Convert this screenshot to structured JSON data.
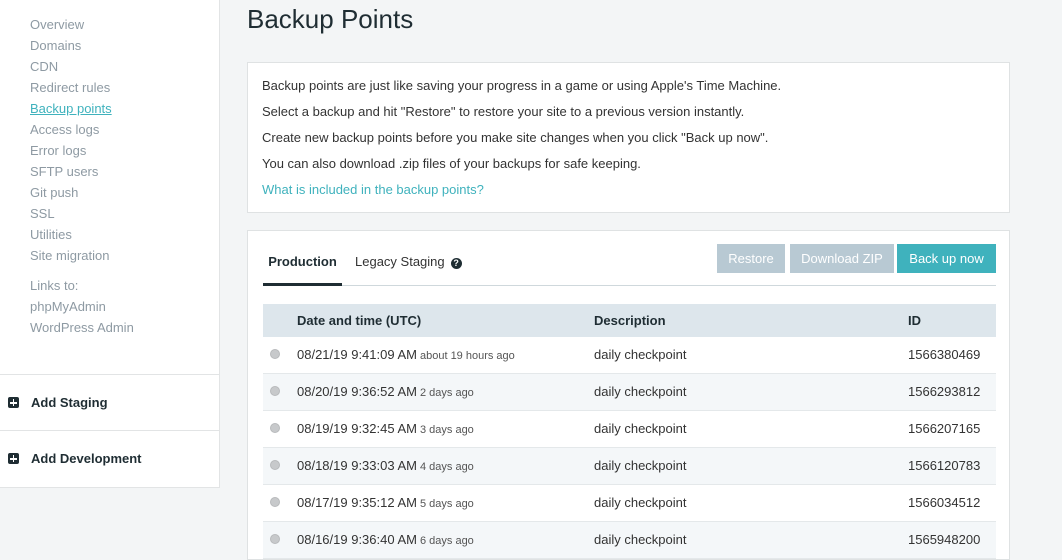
{
  "sidebar": {
    "nav": [
      {
        "label": "Overview",
        "active": false
      },
      {
        "label": "Domains",
        "active": false
      },
      {
        "label": "CDN",
        "active": false
      },
      {
        "label": "Redirect rules",
        "active": false
      },
      {
        "label": "Backup points",
        "active": true
      },
      {
        "label": "Access logs",
        "active": false
      },
      {
        "label": "Error logs",
        "active": false
      },
      {
        "label": "SFTP users",
        "active": false
      },
      {
        "label": "Git push",
        "active": false
      },
      {
        "label": "SSL",
        "active": false
      },
      {
        "label": "Utilities",
        "active": false
      },
      {
        "label": "Site migration",
        "active": false
      }
    ],
    "links_to_title": "Links to:",
    "links": [
      "phpMyAdmin",
      "WordPress Admin"
    ],
    "add_staging": "Add Staging",
    "add_development": "Add Development"
  },
  "page": {
    "title": "Backup Points"
  },
  "info": {
    "lines": [
      "Backup points are just like saving your progress in a game or using Apple's Time Machine.",
      "Select a backup and hit \"Restore\" to restore your site to a previous version instantly.",
      "Create new backup points before you make site changes when you click \"Back up now\".",
      "You can also download .zip files of your backups for safe keeping."
    ],
    "link": "What is included in the backup points?"
  },
  "tabs": {
    "production": "Production",
    "legacy": "Legacy Staging",
    "help_icon": "?"
  },
  "buttons": {
    "restore": "Restore",
    "download": "Download ZIP",
    "backup": "Back up now"
  },
  "table": {
    "headers": {
      "date": "Date and time (UTC)",
      "description": "Description",
      "id": "ID"
    },
    "rows": [
      {
        "date": "08/21/19 9:41:09 AM",
        "relative": "about 19 hours ago",
        "description": "daily checkpoint",
        "id": "1566380469"
      },
      {
        "date": "08/20/19 9:36:52 AM",
        "relative": "2 days ago",
        "description": "daily checkpoint",
        "id": "1566293812"
      },
      {
        "date": "08/19/19 9:32:45 AM",
        "relative": "3 days ago",
        "description": "daily checkpoint",
        "id": "1566207165"
      },
      {
        "date": "08/18/19 9:33:03 AM",
        "relative": "4 days ago",
        "description": "daily checkpoint",
        "id": "1566120783"
      },
      {
        "date": "08/17/19 9:35:12 AM",
        "relative": "5 days ago",
        "description": "daily checkpoint",
        "id": "1566034512"
      },
      {
        "date": "08/16/19 9:36:40 AM",
        "relative": "6 days ago",
        "description": "daily checkpoint",
        "id": "1565948200"
      }
    ]
  },
  "colors": {
    "accent": "#3fb2bd",
    "disabled_button": "#b8c9d3",
    "dark": "#1f2d33"
  }
}
